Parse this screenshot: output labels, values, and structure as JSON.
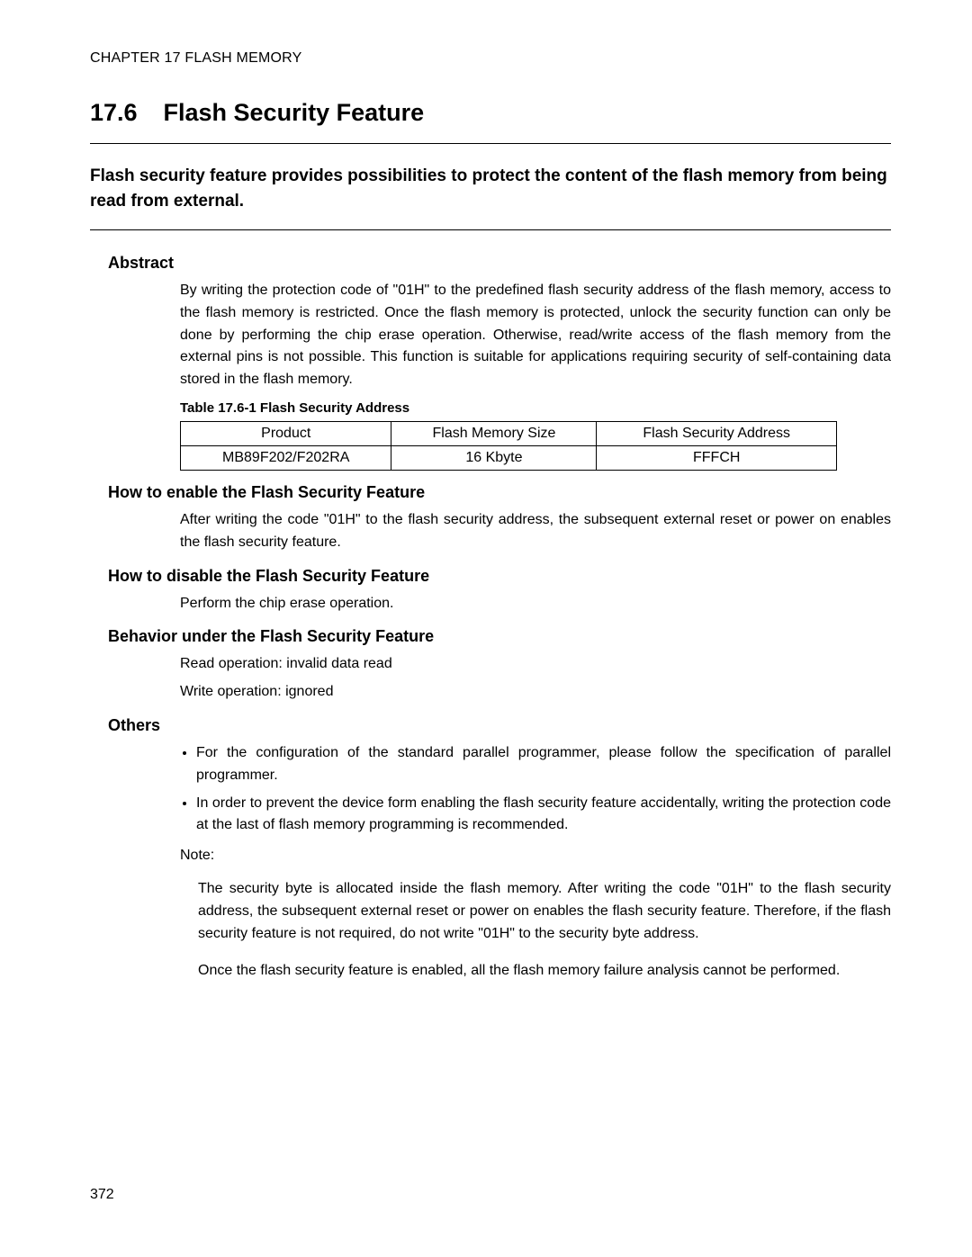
{
  "chapter_header": "CHAPTER 17  FLASH MEMORY",
  "section_number": "17.6",
  "section_title": "Flash Security Feature",
  "lead": "Flash security feature provides possibilities to protect the content of the flash memory from being read from external.",
  "abstract_heading": "Abstract",
  "abstract_body": "By writing the protection code of \"01H\" to the predefined flash security address of the flash memory, access to the flash memory is restricted. Once the flash memory is protected, unlock the security function can only be done by performing the chip erase operation. Otherwise, read/write access of the flash memory from the external pins is not possible. This function is suitable for applications requiring security of self-containing data stored in the flash memory.",
  "table_caption": "Table 17.6-1  Flash Security Address",
  "table": {
    "headers": [
      "Product",
      "Flash Memory Size",
      "Flash Security Address"
    ],
    "row": [
      "MB89F202/F202RA",
      "16 Kbyte",
      "FFFCH"
    ]
  },
  "enable_heading": "How to enable the Flash Security Feature",
  "enable_body": "After writing the code \"01H\" to the flash security address, the subsequent external reset or power on enables the flash security feature.",
  "disable_heading": "How to disable the Flash Security Feature",
  "disable_body": "Perform the chip erase operation.",
  "behavior_heading": "Behavior under the Flash Security Feature",
  "behavior_read": "Read operation: invalid data read",
  "behavior_write": "Write operation: ignored",
  "others_heading": "Others",
  "others_items": [
    "For the configuration of the standard parallel programmer, please follow the specification of parallel programmer.",
    "In order to prevent the device form enabling the flash security feature accidentally, writing the protection code at the last of flash memory programming is recommended."
  ],
  "note_label": "Note:",
  "note_p1": "The security byte is allocated inside the flash memory. After writing the code \"01H\" to the flash security address, the subsequent external reset or power on enables the flash security feature. Therefore, if the flash security feature is not required, do not write \"01H\" to the security byte address.",
  "note_p2": "Once the flash security feature is enabled, all the flash memory failure analysis cannot be performed.",
  "page_number": "372"
}
